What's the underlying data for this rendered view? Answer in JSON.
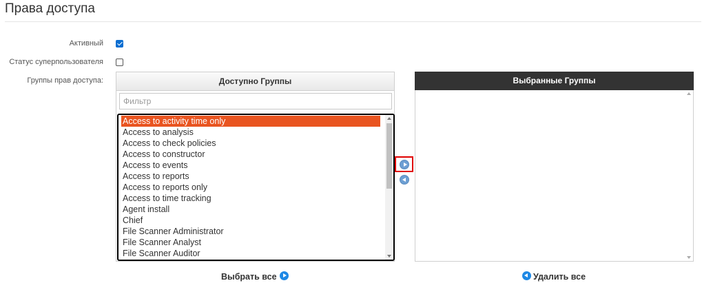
{
  "page": {
    "title": "Права доступа"
  },
  "form": {
    "active_label": "Активный",
    "active_checked": true,
    "superuser_label": "Статус суперпользователя",
    "superuser_checked": false,
    "groups_label": "Группы прав доступа:"
  },
  "available": {
    "header": "Доступно Группы",
    "filter_placeholder": "Фильтр",
    "filter_value": "",
    "selected_index": 0,
    "items": [
      "Access to activity time only",
      "Access to analysis",
      "Access to check policies",
      "Access to constructor",
      "Access to events",
      "Access to reports",
      "Access to reports only",
      "Access to time tracking",
      "Agent install",
      "Chief",
      "File Scanner Administrator",
      "File Scanner Analyst",
      "File Scanner Auditor"
    ]
  },
  "chosen": {
    "header": "Выбранные Группы",
    "items": []
  },
  "actions": {
    "choose_all": "Выбрать все",
    "remove_all": "Удалить все"
  },
  "colors": {
    "selection": "#e95420",
    "chosen_header": "#333333",
    "accent_blue": "#1e88e5",
    "highlight_border": "#e00000"
  }
}
